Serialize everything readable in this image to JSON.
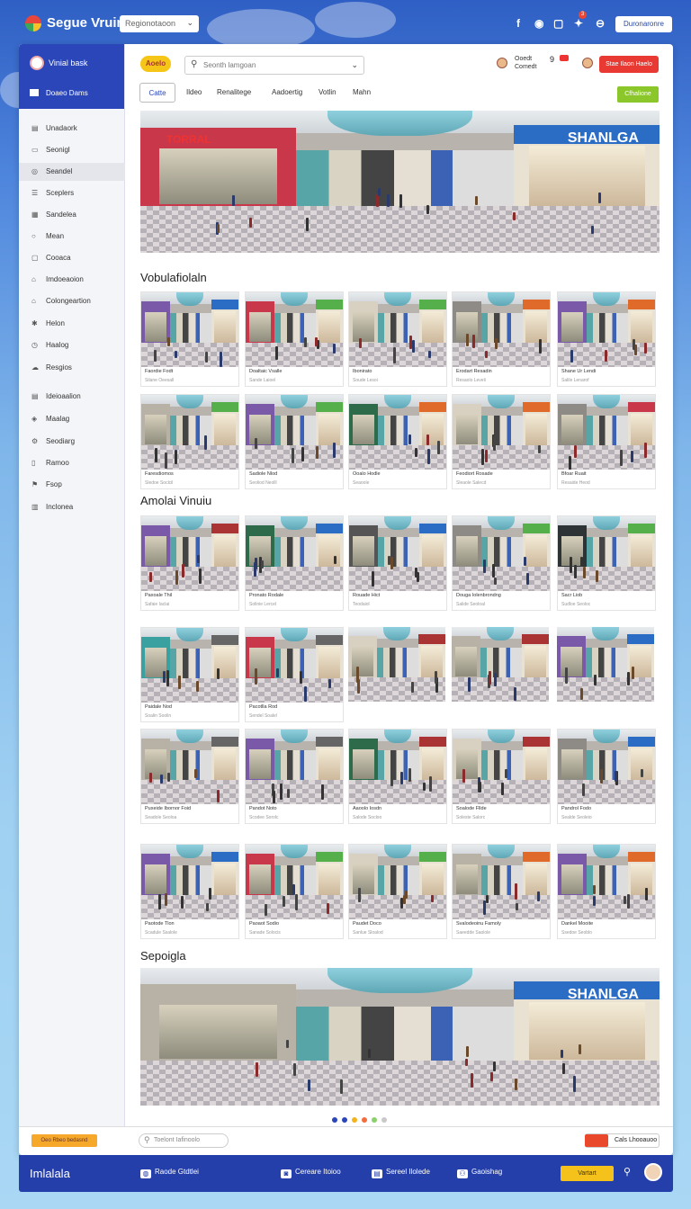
{
  "app": {
    "title": "Segue Vruin",
    "region_select": "Regionotaoon"
  },
  "topbar": {
    "icons": [
      "facebook-icon",
      "instagram-icon",
      "file-icon",
      "notification-icon",
      "minus-icon"
    ],
    "notification_count": "3",
    "button_label": "Duronaronre"
  },
  "sidebar": {
    "user": "Vinial bask",
    "subheader": "Doaeo Dams",
    "items": [
      {
        "label": "Unadaork",
        "icon": "clipboard-icon"
      },
      {
        "label": "Seonigl",
        "icon": "doc-icon"
      },
      {
        "label": "Seandel",
        "icon": "circle-icon",
        "active": true
      },
      {
        "label": "Sceplers",
        "icon": "list-icon"
      },
      {
        "label": "Sandelea",
        "icon": "grid-icon"
      },
      {
        "label": "Mean",
        "icon": "ring-icon"
      },
      {
        "label": "Cooaca",
        "icon": "box-icon"
      },
      {
        "label": "Imdoeaoion",
        "icon": "tag-icon"
      },
      {
        "label": "Colongeartion",
        "icon": "home-icon"
      },
      {
        "label": "Helon",
        "icon": "settings-icon"
      },
      {
        "label": "Haalog",
        "icon": "info-icon"
      },
      {
        "label": "Resgios",
        "icon": "cloud-icon"
      },
      {
        "label": "Ideioaalion",
        "icon": "chart-icon"
      },
      {
        "label": "Maalag",
        "icon": "shield-icon"
      },
      {
        "label": "Seodiarg",
        "icon": "gear-icon"
      },
      {
        "label": "Ramoo",
        "icon": "page-icon"
      },
      {
        "label": "Fsop",
        "icon": "map-icon"
      },
      {
        "label": "Inclonea",
        "icon": "table-icon"
      }
    ]
  },
  "header": {
    "tag": "Aoelo",
    "search_placeholder": "Seonth lamgoan",
    "user1_name": "Ooedt",
    "user1_sub": "Comedt",
    "user1_count": "9",
    "action_button": "Stae Ilaon Haelo",
    "tabs": [
      "Catte",
      "Ildeo",
      "Renalitege",
      "Aadoertig",
      "Votlin",
      "Mahn"
    ],
    "green_button": "Cfhalione"
  },
  "hero": {
    "sign_left": "TORRAL",
    "sign_right": "SHANLGA"
  },
  "sections": [
    {
      "title": "Vobulafiolaln"
    },
    {
      "title": "Amolai Vinuiu"
    },
    {
      "title": "Sepoigla"
    }
  ],
  "grid1": [
    {
      "title": "Faordie Fodt",
      "sub": "Silane Oeesall"
    },
    {
      "title": "Doaltaic Vsalle",
      "sub": "Sande Laioel"
    },
    {
      "title": "Ibonirato",
      "sub": "Soude Lesoi"
    },
    {
      "title": "Erodart Resadin",
      "sub": "Resaolo Leveli"
    },
    {
      "title": "Shane Ur Lendi",
      "sub": "Salile Lenarof"
    },
    {
      "title": "Faresdiomos",
      "sub": "Sledoe Soclcil"
    },
    {
      "title": "Sadiole Nlod",
      "sub": "Seoliod Neolll"
    },
    {
      "title": "Ooalo Hodle",
      "sub": "Seaoole"
    },
    {
      "title": "Feodiort Rosade",
      "sub": "Sleaole Salecd"
    },
    {
      "title": "Bfoar Ruait",
      "sub": "Resaide Heod"
    }
  ],
  "grid2": [
    {
      "title": "Paxoale Thil",
      "sub": "Safaie Iaclai"
    },
    {
      "title": "Pronato Rodale",
      "sub": "Solinie Lercel"
    },
    {
      "title": "Rouade Hict",
      "sub": "Teodaiol"
    },
    {
      "title": "Douga Iolenbrondng",
      "sub": "Salide Seoloal"
    },
    {
      "title": "Sacr Liob",
      "sub": "Sudloe Seoloc"
    },
    {
      "title": "Paidale Nod",
      "sub": "Soalin Soolin"
    },
    {
      "title": "Pacotlla Rod",
      "sub": "Sendel Soalel"
    },
    {
      "title": "",
      "sub": ""
    },
    {
      "title": "",
      "sub": ""
    },
    {
      "title": "",
      "sub": ""
    },
    {
      "title": "Puxeide Ibornor Foid",
      "sub": "Seadole Seoloa"
    },
    {
      "title": "Pandot Noto",
      "sub": "Scodee Sorolc"
    },
    {
      "title": "Aaoolo Iosdn",
      "sub": "Salode Socloo"
    },
    {
      "title": "Soalode Fllde",
      "sub": "Soleste Salorc"
    },
    {
      "title": "Pandrol Fodo",
      "sub": "Sealde Seoleio"
    },
    {
      "title": "Paotode Tlon",
      "sub": "Scadule Ssalole"
    },
    {
      "title": "Paoaot Sodio",
      "sub": "Sanade Solocis"
    },
    {
      "title": "Paudet Doco",
      "sub": "Sanlue Sloalod"
    },
    {
      "title": "Svalodeoinu Famoly",
      "sub": "Saeedde Saolole"
    },
    {
      "title": "Dankel Mooite",
      "sub": "Ssedoe Seoblo"
    }
  ],
  "carousel": {
    "dots": [
      "#2b46b8",
      "#2b46b8",
      "#f2b31d",
      "#f26d3c",
      "#8ad06b",
      "#c9c9c9"
    ]
  },
  "statusbar": {
    "left_button": "Oeo Rbeo bedasnd",
    "search_placeholder": "Toelont Iafinoolo",
    "right_label": "Cals Lhooauoo"
  },
  "bottombar": {
    "brand": "Imlalala",
    "items": [
      {
        "label": "Raode Gtdtlei",
        "icon": "globe-icon"
      },
      {
        "label": "Cereare Itoioo",
        "icon": "chat-icon"
      },
      {
        "label": "Sereel Ilolede",
        "icon": "clipboard-icon"
      },
      {
        "label": "Gaoishag",
        "icon": "people-icon"
      }
    ],
    "button": "Vartart"
  },
  "colors": {
    "primary": "#2b46b8",
    "accent_red": "#e83a32",
    "accent_green": "#8bc72b",
    "accent_amber": "#f5c518"
  }
}
